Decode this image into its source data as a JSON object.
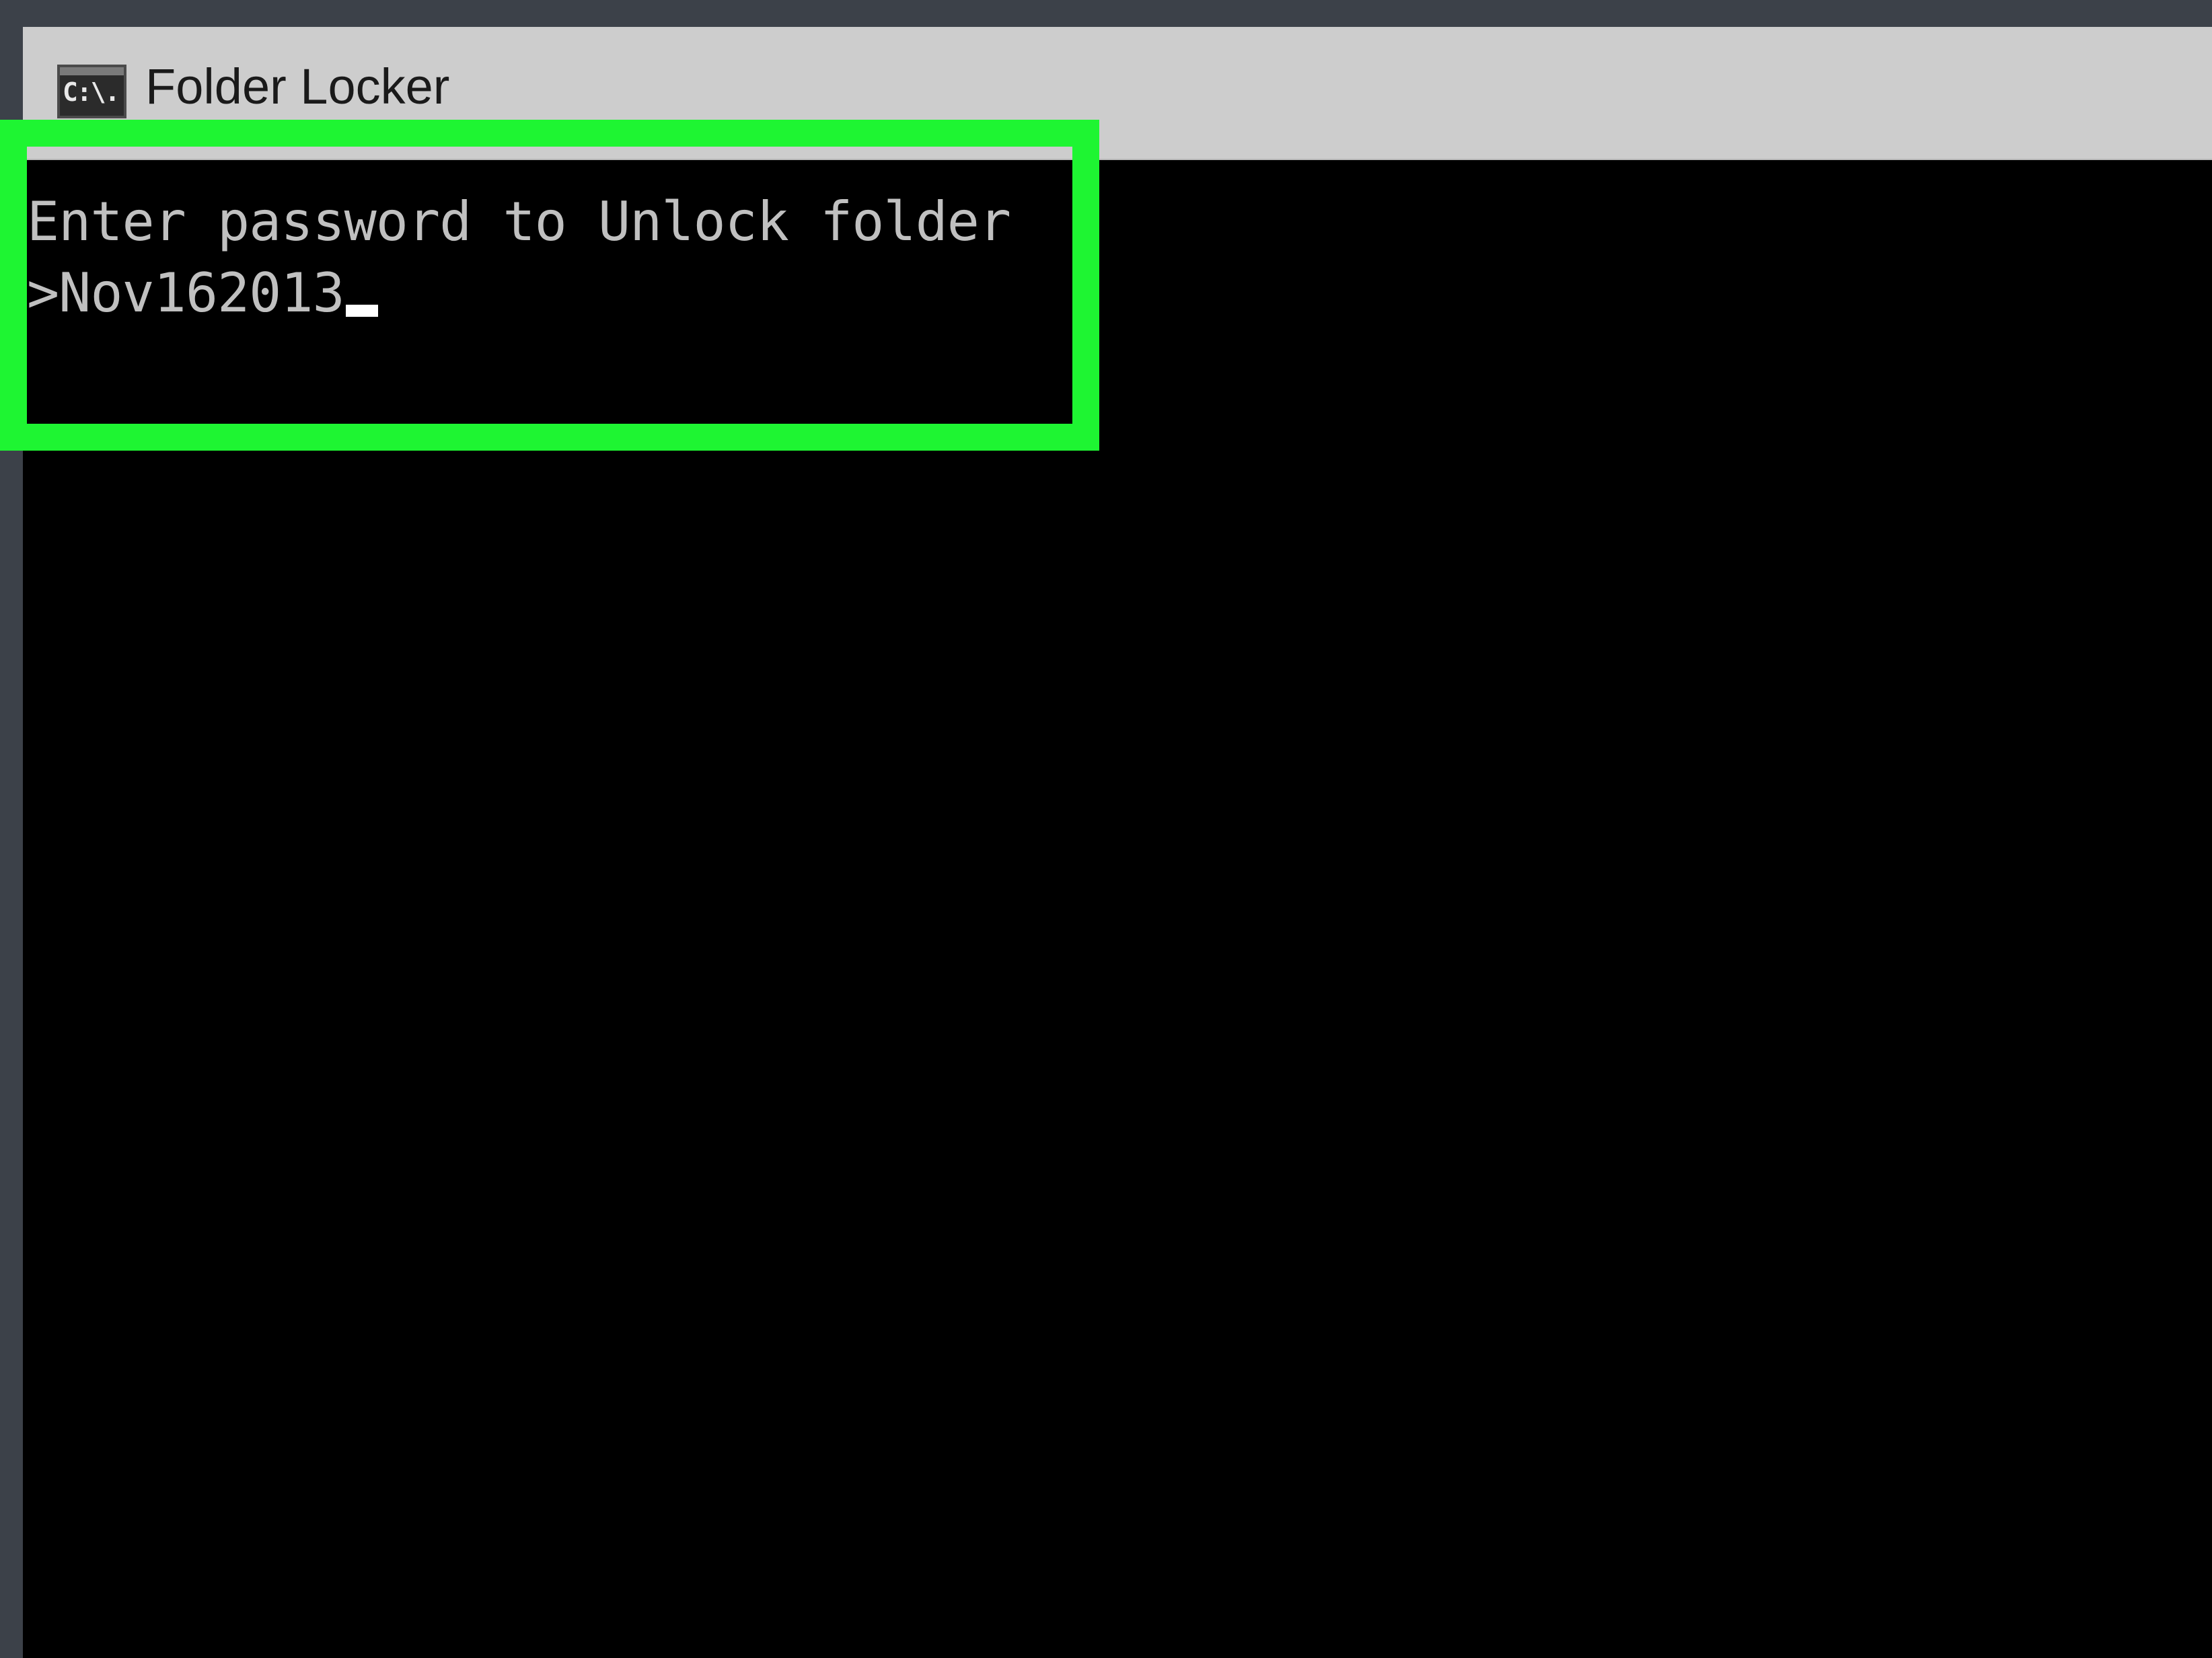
{
  "window": {
    "title": "Folder Locker",
    "icon": "command-prompt-icon",
    "icon_text": "C:\\."
  },
  "console": {
    "prompt_message": "Enter password to Unlock folder",
    "input_prefix": ">",
    "input_value": "Nov162013"
  },
  "colors": {
    "highlight": "#1ef532",
    "console_background": "#000000",
    "console_text": "#c0c0c0",
    "titlebar": "#cdcdcd",
    "desktop": "#3c4149"
  }
}
